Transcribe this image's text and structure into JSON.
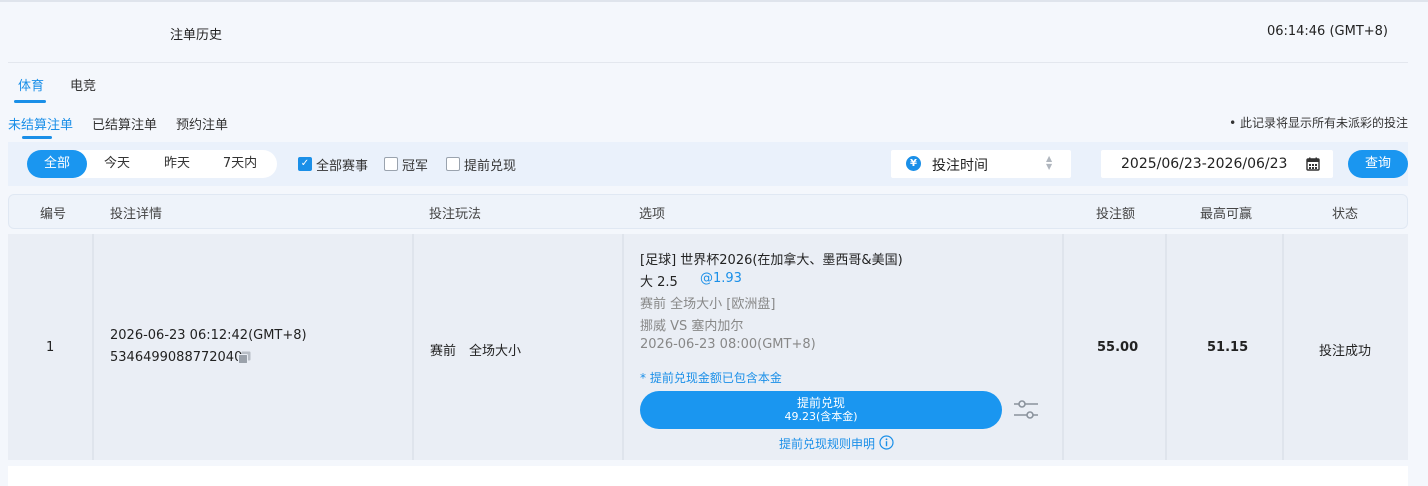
{
  "header": {
    "title": "注单历史",
    "time": "06:14:46 (GMT+8)"
  },
  "main_tabs": [
    {
      "label": "体育",
      "active": true
    },
    {
      "label": "电竞",
      "active": false
    }
  ],
  "sub_tabs": [
    {
      "label": "未结算注单",
      "active": true
    },
    {
      "label": "已结算注单",
      "active": false
    },
    {
      "label": "预约注单",
      "active": false
    }
  ],
  "note": "• 此记录将显示所有未派彩的投注",
  "filters": {
    "periods": [
      "全部",
      "今天",
      "昨天",
      "7天内"
    ],
    "active_period": "全部",
    "checkboxes": [
      {
        "label": "全部赛事",
        "checked": true
      },
      {
        "label": "冠军",
        "checked": false
      },
      {
        "label": "提前兑现",
        "checked": false
      }
    ],
    "sort_label": "投注时间",
    "currency_symbol": "¥",
    "date_range": "2025/06/23-2026/06/23",
    "query_label": "查询"
  },
  "table": {
    "headers": [
      "编号",
      "投注详情",
      "投注玩法",
      "选项",
      "投注额",
      "最高可赢",
      "状态"
    ],
    "rows": [
      {
        "no": "1",
        "time": "2026-06-23 06:12:42(GMT+8)",
        "bet_id": "5346499088772040",
        "play": "赛前　全场大小",
        "league": "[足球] 世界杯2026(在加拿大、墨西哥&美国)",
        "selection": "大 2.5",
        "odds": "@1.93",
        "market": "赛前 全场大小 [欧洲盘]",
        "match": "挪威 VS 塞内加尔",
        "match_time": "2026-06-23 08:00(GMT+8)",
        "cashout_note": "* 提前兑现金额已包含本金",
        "cashout_label": "提前兑现",
        "cashout_amount": "49.23(含本金)",
        "cashout_rules": "提前兑现规则申明",
        "stake": "55.00",
        "max_win": "51.15",
        "status": "投注成功"
      }
    ]
  },
  "colors": {
    "accent": "#1a96f0",
    "background": "#f4f7fc"
  }
}
